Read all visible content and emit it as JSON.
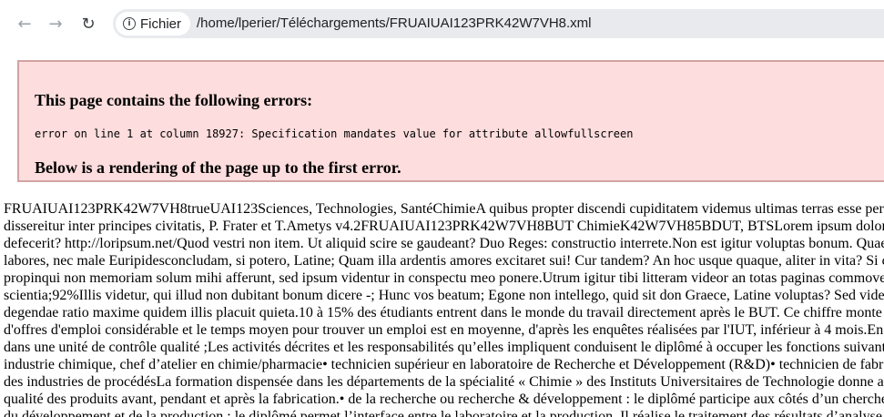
{
  "browser": {
    "back_icon": "arrow-left-icon",
    "forward_icon": "arrow-right-icon",
    "reload_icon": "reload-icon",
    "site_info_label": "Fichier",
    "url": "/home/lperier/Téléchargements/FRUAIUAI123PRK42W7VH8.xml"
  },
  "error": {
    "heading": "This page contains the following errors:",
    "detail": "error on line 1 at column 18927: Specification mandates value for attribute allowfullscreen",
    "footer": "Below is a rendering of the page up to the first error."
  },
  "rendered_lines": [
    "FRUAIUAI123PRK42W7VH8trueUAI123Sciences, Technologies, SantéChimieA quibus propter discendi cupiditatem videmus ultimas terras esse per",
    "dissereitur inter principes civitatis, P. Frater et T.Ametys v4.2FRUAIUAI123PRK42W7VH8BUT ChimieK42W7VH85BDUT, BTSLorem ipsum dolor",
    "defecerit? http://loripsum.net/Quod vestri non item. Ut aliquid scire se gaudeant? Duo Reges: constructio interrete.Non est igitur voluptas bonum. Quae",
    "labores, nec male Euripidesconcludam, si potero, Latine; Quam illa ardentis amores excitaret sui! Cur tandem? An hoc usque quaque, aliter in vita? Si c",
    "propinqui non memoriam solum mihi afferunt, sed ipsum videntur in conspectu meo ponere.Utrum igitur tibi litteram videor an totas paginas commove",
    "scientia;92%Illis videtur, qui illud non dubitant bonum dicere -; Hunc vos beatum; Egone non intellego, quid sit don Graece, Latine voluptas? Sed vide",
    "degendae ratio maxime quidem illis placuit quieta.10 à 15% des étudiants entrent dans le monde du travail directement après le BUT. Ce chiffre monte",
    "d'offres d'emploi considérable et le temps moyen pour trouver un emploi est en moyenne, d'après les enquêtes réalisées par l'IUT, inférieur à 4 mois.En",
    "dans une unité de contrôle qualité ;Les activités décrites et les responsabilités qu’elles impliquent conduisent le diplômé à occuper les fonctions suivant",
    "industrie chimique, chef d’atelier en chimie/pharmacie• technicien supérieur en laboratoire de Recherche et Développement (R&D)• technicien de fabr",
    "des industries de procédésLa formation dispensée dans les départements de la spécialité « Chimie » des Instituts Universitaires de Technologie donne a",
    "qualité des produits avant, pendant et après la fabrication.• de la recherche ou recherche & développement : le diplômé participe aux côtés d’un cherche",
    "du développement et de la production : le diplômé permet l’interface entre le laboratoire et la production. Il réalise le traitement des résultats d’analyse"
  ]
}
